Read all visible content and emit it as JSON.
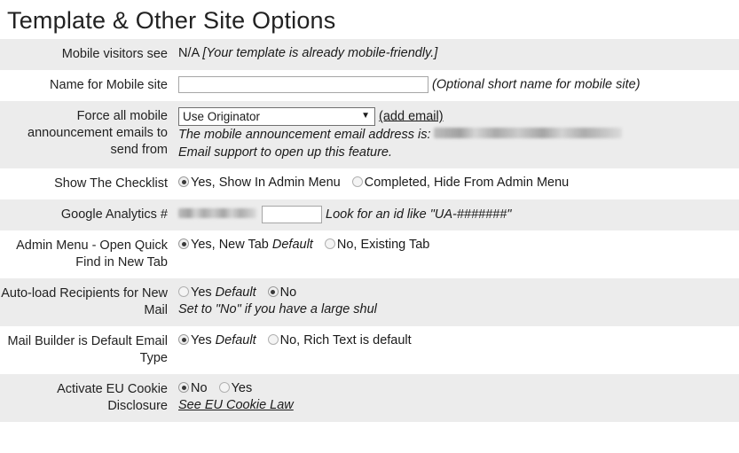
{
  "page": {
    "title": "Template & Other Site Options"
  },
  "rows": [
    {
      "label": "Mobile visitors see",
      "value_prefix": "N/A",
      "value_note": "[Your template is already mobile-friendly.]"
    },
    {
      "label": "Name for Mobile site",
      "input_value": "",
      "input_placeholder": "",
      "value_note": "(Optional short name for mobile site)"
    },
    {
      "label": "Force all mobile announcement emails to send from",
      "select_value": "Use Originator",
      "select_arrow": "▼",
      "add_email_link": "(add email)",
      "note_line_1": "The mobile announcement email address is:",
      "note_line_1_redacted": "",
      "note_line_2": "Email support to open up this feature."
    },
    {
      "label": "Show The Checklist",
      "options": [
        {
          "label": "Yes, Show In Admin Menu",
          "checked": true,
          "default_tag": ""
        },
        {
          "label": "Completed, Hide From Admin Menu",
          "checked": false,
          "default_tag": ""
        }
      ]
    },
    {
      "label": "Google Analytics #",
      "redacted_value": "",
      "input_value": "",
      "value_note": "Look for an id like \"UA-#######\""
    },
    {
      "label": "Admin Menu - Open Quick Find in New Tab",
      "options": [
        {
          "label": "Yes, New Tab",
          "checked": true,
          "default_tag": "Default"
        },
        {
          "label": "No, Existing Tab",
          "checked": false,
          "default_tag": ""
        }
      ]
    },
    {
      "label": "Auto-load Recipients for New Mail",
      "options": [
        {
          "label": "Yes",
          "checked": false,
          "default_tag": "Default"
        },
        {
          "label": "No",
          "checked": true,
          "default_tag": ""
        }
      ],
      "value_note": "Set to \"No\" if you have a large shul"
    },
    {
      "label": "Mail Builder is Default Email Type",
      "options": [
        {
          "label": "Yes",
          "checked": true,
          "default_tag": "Default"
        },
        {
          "label": "No, Rich Text is default",
          "checked": false,
          "default_tag": ""
        }
      ]
    },
    {
      "label": "Activate EU Cookie Disclosure",
      "options": [
        {
          "label": "No",
          "checked": true,
          "default_tag": ""
        },
        {
          "label": "Yes",
          "checked": false,
          "default_tag": ""
        }
      ],
      "link_text": "See EU Cookie Law"
    }
  ],
  "colors": {
    "row_shaded": "#ececec",
    "row_plain": "#ffffff",
    "text": "#1a1a1a"
  }
}
